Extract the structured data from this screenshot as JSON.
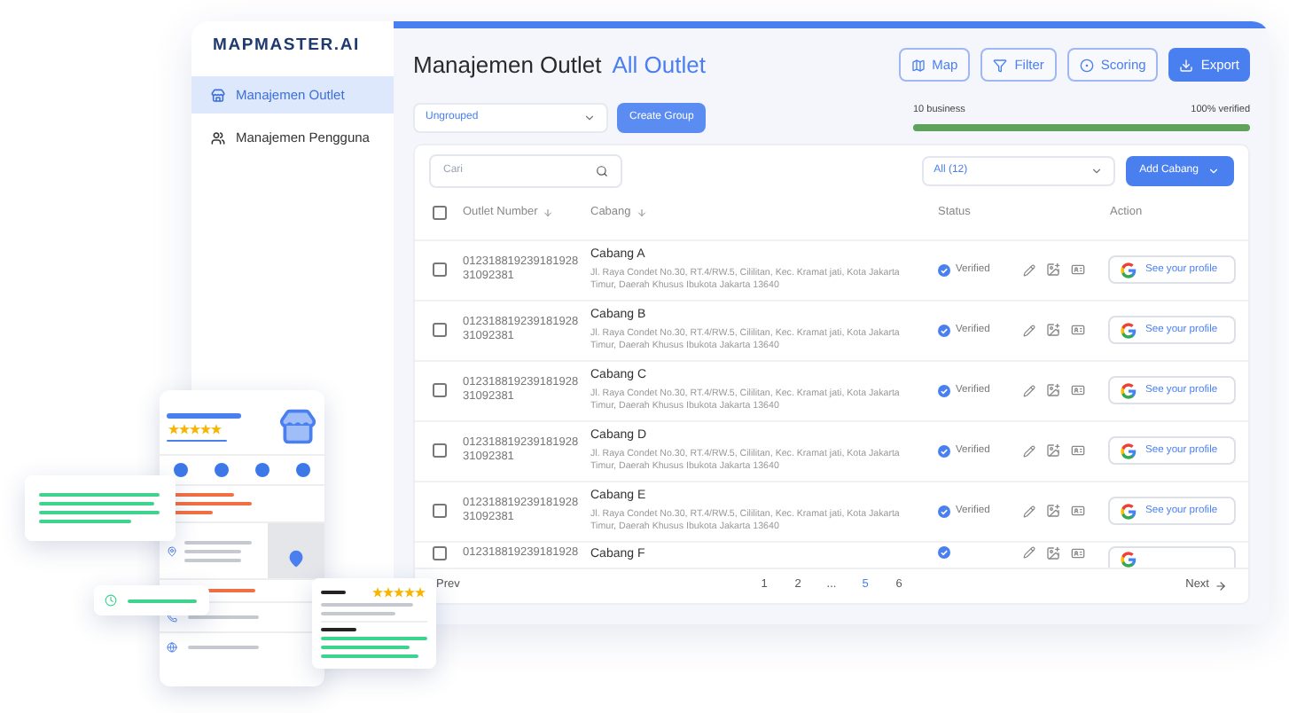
{
  "logo": "MAPMASTER.AI",
  "sidebar": {
    "items": [
      {
        "label": "Manajemen Outlet",
        "selected": true
      },
      {
        "label": "Manajemen Pengguna",
        "selected": false
      }
    ]
  },
  "header": {
    "title": "Manajemen Outlet",
    "subtitle": "All Outlet",
    "buttons": [
      {
        "label": "Map",
        "kind": "outline"
      },
      {
        "label": "Filter",
        "kind": "outline"
      },
      {
        "label": "Scoring",
        "kind": "outline"
      },
      {
        "label": "Export",
        "kind": "primary"
      }
    ]
  },
  "group_select": {
    "value": "Ungrouped"
  },
  "create_group_button": "Create Group",
  "summary": {
    "business": "10 business",
    "verified": "100% verified",
    "level": 1
  },
  "table": {
    "search": {
      "placeholder": "Cari"
    },
    "filter": {
      "value": "All (12)"
    },
    "add_button": "Add Cabang",
    "header_checked": false,
    "columns": [
      {
        "label": "Outlet Number",
        "sortable": true
      },
      {
        "label": "Cabang",
        "sortable": true
      },
      {
        "label": "Status",
        "sortable": false
      },
      {
        "label": "Action",
        "sortable": false
      }
    ],
    "rows": [
      {
        "checked": false,
        "number": "012318819239181928 31092381",
        "name": "Cabang A",
        "address": "Jl. Raya Condet No.30, RT.4/RW.5, Cililitan, Kec. Kramat jati, Kota Jakarta Timur, Daerah Khusus Ibukota Jakarta 13640",
        "status": "Verified",
        "action": "See your profile"
      },
      {
        "checked": false,
        "number": "012318819239181928 31092381",
        "name": "Cabang B",
        "address": "Jl. Raya Condet No.30, RT.4/RW.5, Cililitan, Kec. Kramat jati, Kota Jakarta Timur, Daerah Khusus Ibukota Jakarta 13640",
        "status": "Verified",
        "action": "See your profile"
      },
      {
        "checked": false,
        "number": "012318819239181928 31092381",
        "name": "Cabang C",
        "address": "Jl. Raya Condet No.30, RT.4/RW.5, Cililitan, Kec. Kramat jati, Kota Jakarta Timur, Daerah Khusus Ibukota Jakarta 13640",
        "status": "Verified",
        "action": "See your profile"
      },
      {
        "checked": false,
        "number": "012318819239181928 31092381",
        "name": "Cabang D",
        "address": "Jl. Raya Condet No.30, RT.4/RW.5, Cililitan, Kec. Kramat jati, Kota Jakarta Timur, Daerah Khusus Ibukota Jakarta 13640",
        "status": "Verified",
        "action": "See your profile"
      },
      {
        "checked": false,
        "number": "012318819239181928 31092381",
        "name": "Cabang E",
        "address": "Jl. Raya Condet No.30, RT.4/RW.5, Cililitan, Kec. Kramat jati, Kota Jakarta Timur, Daerah Khusus Ibukota Jakarta 13640",
        "status": "Verified",
        "action": "See your profile"
      },
      {
        "checked": false,
        "number": "012318819239181928",
        "name": "Cabang F"
      }
    ]
  },
  "pagination": {
    "prev": "Prev",
    "next": "Next",
    "pages": [
      {
        "label": "1",
        "selected": false
      },
      {
        "label": "2",
        "selected": false
      },
      {
        "label": "...",
        "selected": false
      },
      {
        "label": "5",
        "selected": true
      },
      {
        "label": "6",
        "selected": false
      }
    ]
  }
}
